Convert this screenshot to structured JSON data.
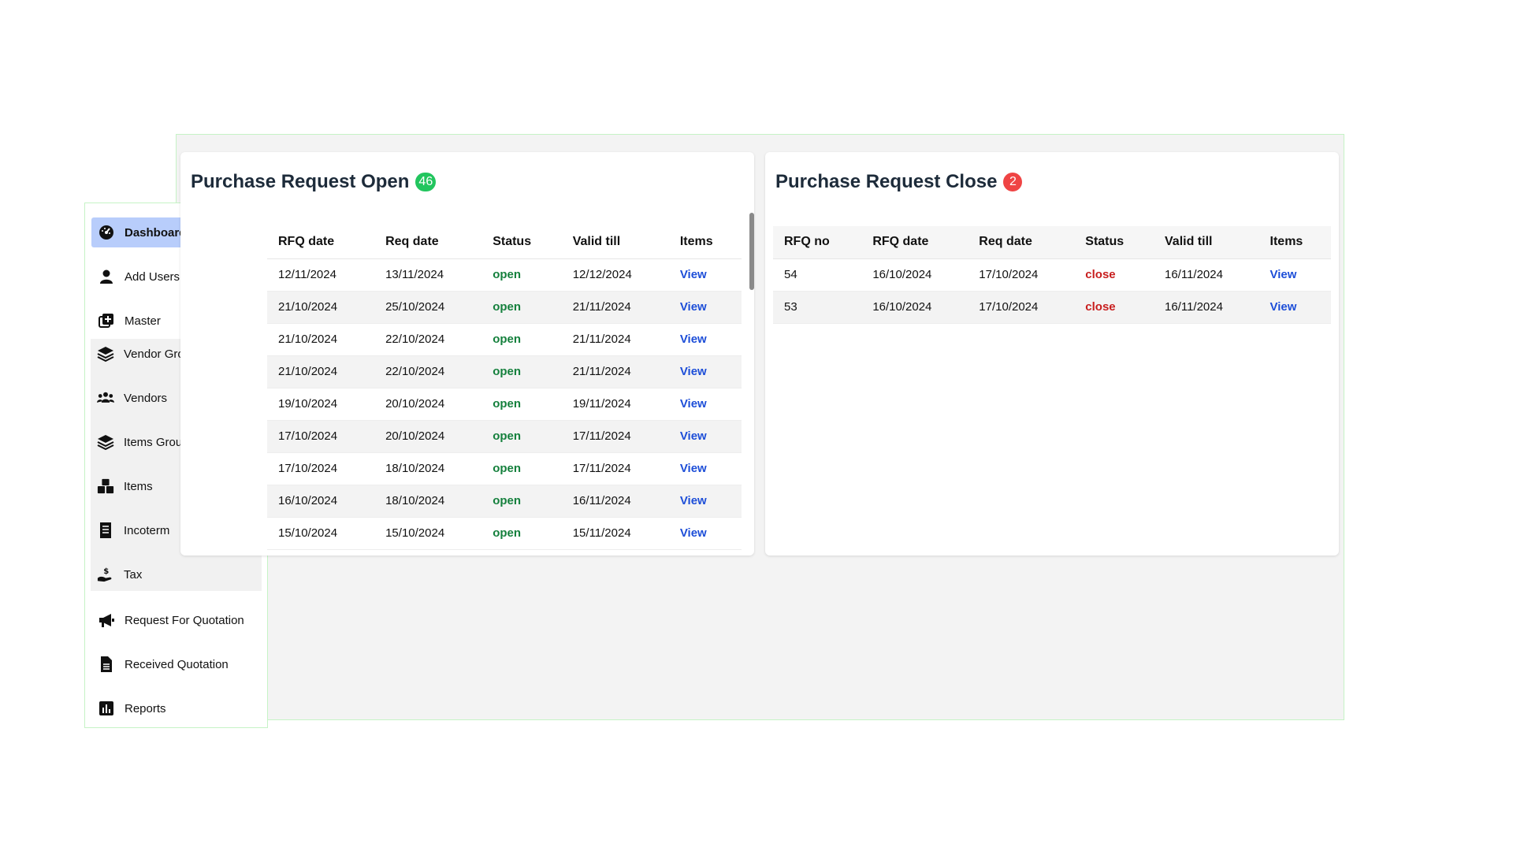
{
  "sidebar": {
    "items": [
      {
        "label": "Dashboard",
        "icon": "dashboard-icon"
      },
      {
        "label": "Add Users",
        "icon": "user-icon"
      },
      {
        "label": "Master",
        "icon": "master-icon"
      },
      {
        "label": "Request For Quotation",
        "icon": "megaphone-icon"
      },
      {
        "label": "Received Quotation",
        "icon": "document-icon"
      },
      {
        "label": "Reports",
        "icon": "reports-icon"
      }
    ],
    "master_sub": [
      {
        "label": "Vendor Group",
        "icon": "layers-icon"
      },
      {
        "label": "Vendors",
        "icon": "users-group-icon"
      },
      {
        "label": "Items Group",
        "icon": "layers-icon"
      },
      {
        "label": "Items",
        "icon": "boxes-icon"
      },
      {
        "label": "Incoterm",
        "icon": "receipt-icon"
      },
      {
        "label": "Tax",
        "icon": "hand-dollar-icon"
      }
    ]
  },
  "open_card": {
    "title": "Purchase Request Open",
    "count": "46",
    "headers": [
      "RFQ date",
      "Req date",
      "Status",
      "Valid till",
      "Items"
    ],
    "rows": [
      [
        "12/11/2024",
        "13/11/2024",
        "open",
        "12/12/2024",
        "View"
      ],
      [
        "21/10/2024",
        "25/10/2024",
        "open",
        "21/11/2024",
        "View"
      ],
      [
        "21/10/2024",
        "22/10/2024",
        "open",
        "21/11/2024",
        "View"
      ],
      [
        "21/10/2024",
        "22/10/2024",
        "open",
        "21/11/2024",
        "View"
      ],
      [
        "19/10/2024",
        "20/10/2024",
        "open",
        "19/11/2024",
        "View"
      ],
      [
        "17/10/2024",
        "20/10/2024",
        "open",
        "17/11/2024",
        "View"
      ],
      [
        "17/10/2024",
        "18/10/2024",
        "open",
        "17/11/2024",
        "View"
      ],
      [
        "16/10/2024",
        "18/10/2024",
        "open",
        "16/11/2024",
        "View"
      ],
      [
        "15/10/2024",
        "15/10/2024",
        "open",
        "15/11/2024",
        "View"
      ]
    ]
  },
  "close_card": {
    "title": "Purchase Request Close",
    "count": "2",
    "headers": [
      "RFQ no",
      "RFQ date",
      "Req date",
      "Status",
      "Valid till",
      "Items"
    ],
    "rows": [
      [
        "54",
        "16/10/2024",
        "17/10/2024",
        "close",
        "16/11/2024",
        "View"
      ],
      [
        "53",
        "16/10/2024",
        "17/10/2024",
        "close",
        "16/11/2024",
        "View"
      ]
    ]
  },
  "colors": {
    "active_nav": "#b8cdfb",
    "open_status": "#15803d",
    "close_status": "#c81e1e",
    "link": "#1d4ed8",
    "badge_open": "#22c55e",
    "badge_close": "#ef4444"
  }
}
